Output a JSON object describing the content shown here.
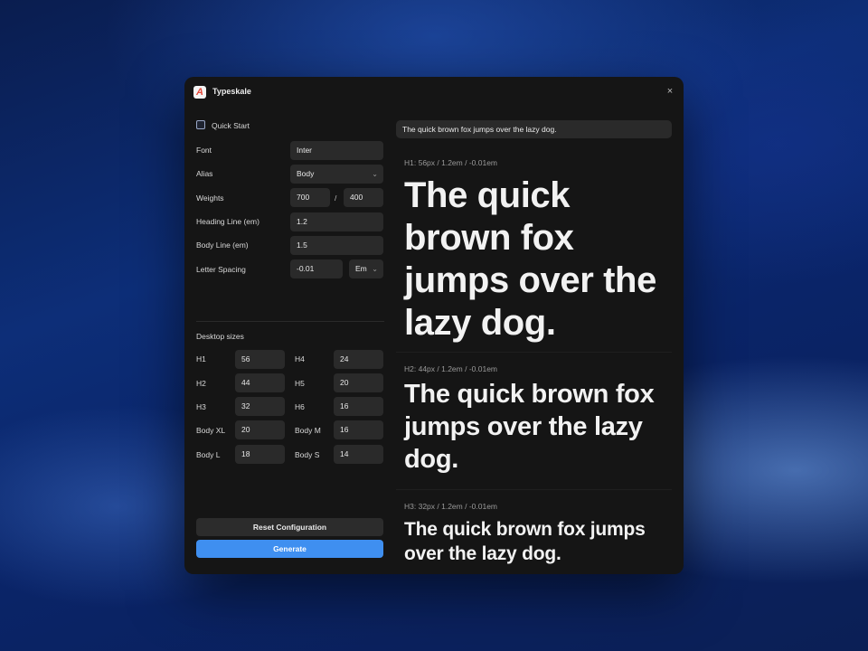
{
  "window": {
    "title": "Typeskale",
    "logo_letter": "A",
    "close_glyph": "×"
  },
  "settings": {
    "quick_start_label": "Quick Start",
    "font": {
      "label": "Font",
      "value": "Inter"
    },
    "alias": {
      "label": "Alias",
      "value": "Body"
    },
    "weights": {
      "label": "Weights",
      "heading": "700",
      "separator": "/",
      "body": "400"
    },
    "heading_line": {
      "label": "Heading Line (em)",
      "value": "1.2"
    },
    "body_line": {
      "label": "Body Line (em)",
      "value": "1.5"
    },
    "letter_spacing": {
      "label": "Letter Spacing",
      "value": "-0.01",
      "unit": "Em"
    }
  },
  "desktop_sizes": {
    "title": "Desktop sizes",
    "left": [
      {
        "label": "H1",
        "value": "56"
      },
      {
        "label": "H2",
        "value": "44"
      },
      {
        "label": "H3",
        "value": "32"
      },
      {
        "label": "Body XL",
        "value": "20"
      },
      {
        "label": "Body L",
        "value": "18"
      }
    ],
    "right": [
      {
        "label": "H4",
        "value": "24"
      },
      {
        "label": "H5",
        "value": "20"
      },
      {
        "label": "H6",
        "value": "16"
      },
      {
        "label": "Body M",
        "value": "16"
      },
      {
        "label": "Body S",
        "value": "14"
      }
    ]
  },
  "buttons": {
    "reset": "Reset Configuration",
    "generate": "Generate"
  },
  "preview": {
    "sample_text": "The quick brown fox jumps over the lazy dog.",
    "blocks": [
      {
        "meta": "H1: 56px / 1.2em / -0.01em",
        "text": "The quick brown fox jumps over the lazy dog."
      },
      {
        "meta": "H2: 44px / 1.2em / -0.01em",
        "text": "The quick brown fox jumps over the lazy dog."
      },
      {
        "meta": "H3: 32px / 1.2em / -0.01em",
        "text": "The quick brown fox jumps over the lazy dog."
      }
    ]
  },
  "colors": {
    "accent": "#3f8ff0",
    "panel": "#151515",
    "field": "#2a2a2a",
    "logo_red": "#e5483a"
  },
  "icons": {
    "logo": "app-logo-icon",
    "close": "close-icon",
    "chevron": "chevron-down-icon"
  }
}
